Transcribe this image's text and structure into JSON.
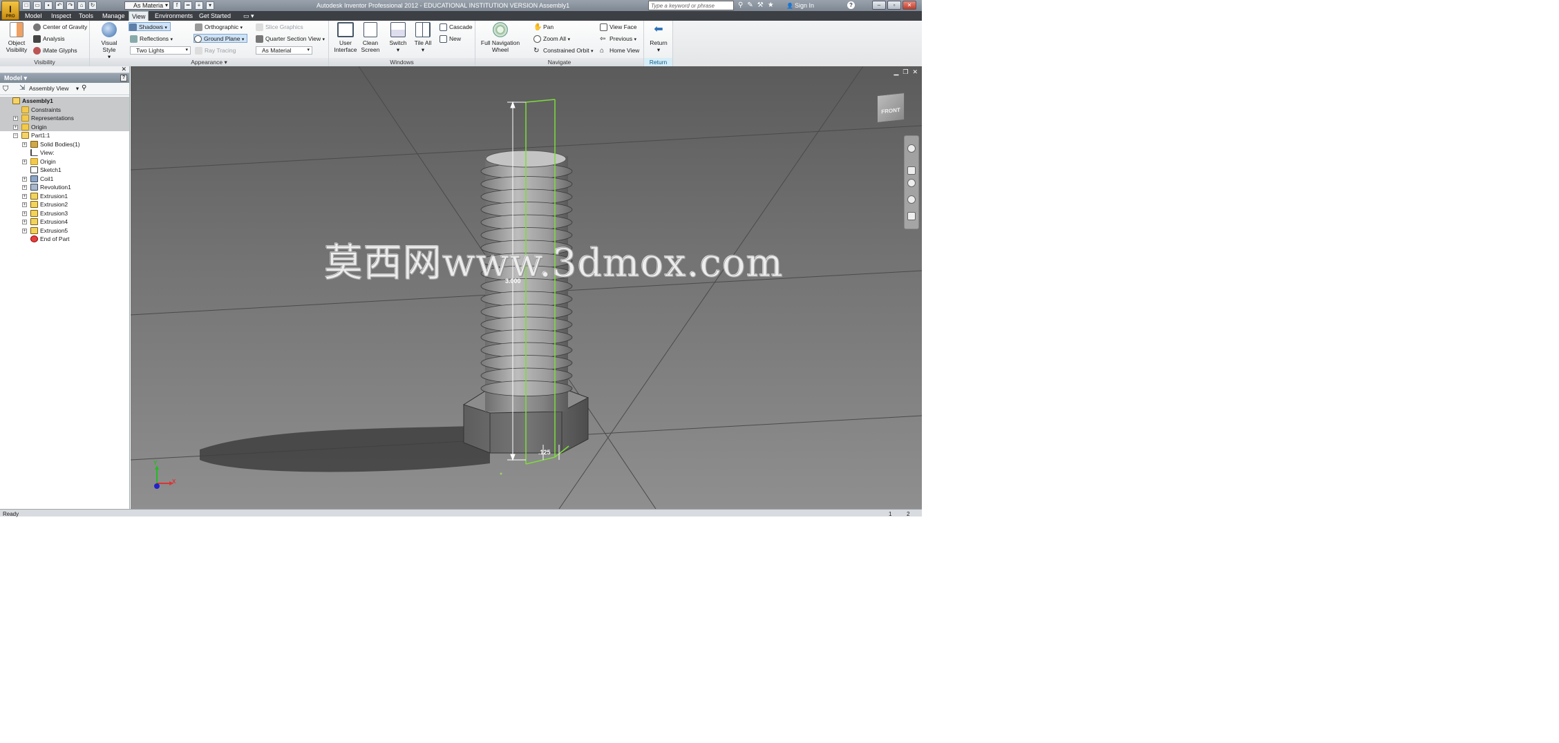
{
  "app": {
    "logo_letter": "I",
    "logo_badge": "PRO",
    "window_title": "Autodesk Inventor Professional 2012 - EDUCATIONAL INSTITUTION VERSION    Assembly1",
    "material_value": "As Materia",
    "help_search_placeholder": "Type a keyword or phrase",
    "sign_in": "Sign In",
    "help": "?"
  },
  "menu": {
    "tabs": [
      {
        "label": "Model"
      },
      {
        "label": "Inspect"
      },
      {
        "label": "Tools"
      },
      {
        "label": "Manage"
      },
      {
        "label": "View",
        "active": true
      },
      {
        "label": "Environments"
      },
      {
        "label": "Get Started"
      }
    ]
  },
  "ribbon": {
    "visibility": {
      "title": "Visibility",
      "object_visibility": "Object\nVisibility",
      "object_visibility_l1": "Object",
      "object_visibility_l2": "Visibility",
      "center_of_gravity": "Center of Gravity",
      "analysis": "Analysis",
      "imate_glyphs": "iMate Glyphs"
    },
    "appearance": {
      "title": "Appearance",
      "visual_style": "Visual Style",
      "shadows": "Shadows",
      "reflections": "Reflections",
      "lighting": "Two Lights",
      "orthographic": "Orthographic",
      "ground_plane": "Ground Plane",
      "ray_tracing": "Ray Tracing",
      "slice_graphics": "Slice Graphics",
      "quarter_section_view": "Quarter Section View",
      "color_override": "As Material"
    },
    "windows": {
      "title": "Windows",
      "user_interface_l1": "User",
      "user_interface_l2": "Interface",
      "clean_screen_l1": "Clean",
      "clean_screen_l2": "Screen",
      "switch": "Switch",
      "tile_all": "Tile All",
      "cascade": "Cascade",
      "new": "New"
    },
    "navigate": {
      "title": "Navigate",
      "full_nav_wheel_l1": "Full Navigation",
      "full_nav_wheel_l2": "Wheel",
      "pan": "Pan",
      "zoom_all": "Zoom All",
      "constrained_orbit": "Constrained Orbit",
      "view_face": "View Face",
      "previous": "Previous",
      "home_view": "Home View"
    },
    "return": {
      "title": "Return",
      "return_label": "Return"
    }
  },
  "browser": {
    "header": "Model ▾",
    "view_selector": "Assembly View",
    "tree": [
      {
        "label": "Assembly1",
        "level": 0,
        "icon": "assembly",
        "bold": true,
        "selected": true,
        "expander": ""
      },
      {
        "label": "Constraints",
        "level": 1,
        "icon": "folder",
        "selected": true,
        "expander": ""
      },
      {
        "label": "Representations",
        "level": 1,
        "icon": "folder",
        "selected": true,
        "expander": "+"
      },
      {
        "label": "Origin",
        "level": 1,
        "icon": "folder",
        "selected": true,
        "expander": "+"
      },
      {
        "label": "Part1:1",
        "level": 1,
        "icon": "part",
        "expander": "-"
      },
      {
        "label": "Solid Bodies(1)",
        "level": 2,
        "icon": "body",
        "expander": "+"
      },
      {
        "label": "View:",
        "level": 2,
        "icon": "view",
        "expander": ""
      },
      {
        "label": "Origin",
        "level": 2,
        "icon": "folder",
        "expander": "+"
      },
      {
        "label": "Sketch1",
        "level": 2,
        "icon": "sketch",
        "expander": ""
      },
      {
        "label": "Coil1",
        "level": 2,
        "icon": "coil",
        "expander": "+"
      },
      {
        "label": "Revolution1",
        "level": 2,
        "icon": "rev",
        "expander": "+"
      },
      {
        "label": "Extrusion1",
        "level": 2,
        "icon": "extr",
        "expander": "+"
      },
      {
        "label": "Extrusion2",
        "level": 2,
        "icon": "extr",
        "expander": "+"
      },
      {
        "label": "Extrusion3",
        "level": 2,
        "icon": "extr",
        "expander": "+"
      },
      {
        "label": "Extrusion4",
        "level": 2,
        "icon": "extr",
        "expander": "+"
      },
      {
        "label": "Extrusion5",
        "level": 2,
        "icon": "extr",
        "expander": "+"
      },
      {
        "label": "End of Part",
        "level": 2,
        "icon": "eop",
        "expander": ""
      }
    ]
  },
  "viewport": {
    "watermark": "莫西网www.3dmox.com",
    "dim_height": "3.000",
    "dim_thickness": ".125",
    "viewcube_face": "FRONT",
    "triad_x": "X",
    "triad_y": "Y"
  },
  "status": {
    "text": "Ready",
    "n1": "1",
    "n2": "2"
  },
  "colors": {
    "sketch_profile": "#7dde3a",
    "selection_blue": "#cfe3f7",
    "axis_x": "#d33",
    "axis_y": "#2b2",
    "axis_z": "#22c"
  }
}
